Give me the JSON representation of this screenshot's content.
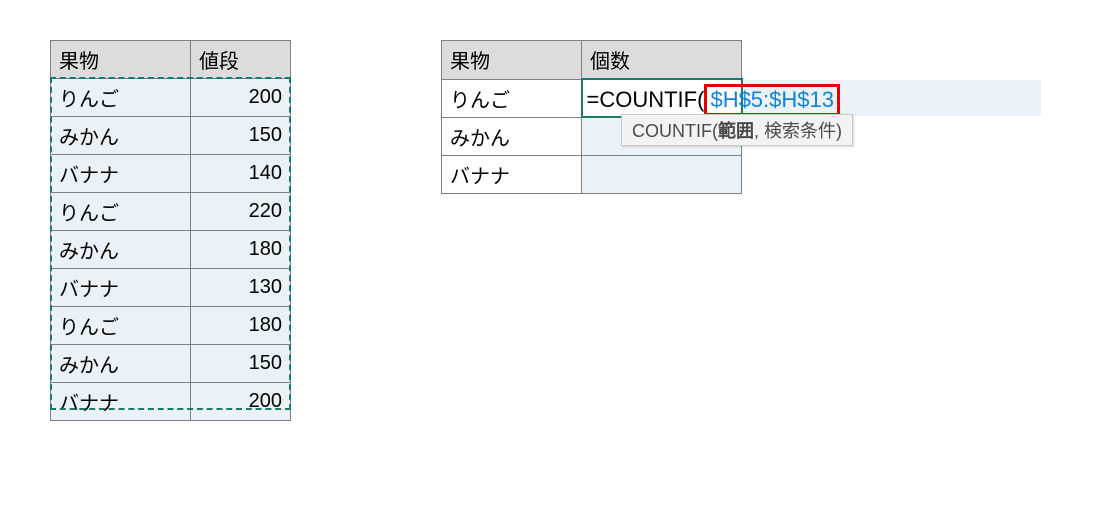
{
  "left": {
    "headers": [
      "果物",
      "値段"
    ],
    "rows": [
      {
        "fruit": "りんご",
        "price": "200"
      },
      {
        "fruit": "みかん",
        "price": "150"
      },
      {
        "fruit": "バナナ",
        "price": "140"
      },
      {
        "fruit": "りんご",
        "price": "220"
      },
      {
        "fruit": "みかん",
        "price": "180"
      },
      {
        "fruit": "バナナ",
        "price": "130"
      },
      {
        "fruit": "りんご",
        "price": "180"
      },
      {
        "fruit": "みかん",
        "price": "150"
      },
      {
        "fruit": "バナナ",
        "price": "200"
      }
    ]
  },
  "right": {
    "headers": [
      "果物",
      "個数"
    ],
    "rows": [
      {
        "fruit": "りんご"
      },
      {
        "fruit": "みかん"
      },
      {
        "fruit": "バナナ"
      }
    ]
  },
  "formula": {
    "prefix": "=COUNTIF(",
    "ref": "$H$5:$H$13"
  },
  "tooltip": {
    "fn": "COUNTIF(",
    "arg1": "範囲",
    "rest": ", 検索条件)"
  },
  "colors": {
    "selection_border": "#1c7a6b",
    "highlight_bg": "#eaf2f7",
    "ref_color": "#1181d6",
    "red_box": "#e30000"
  }
}
